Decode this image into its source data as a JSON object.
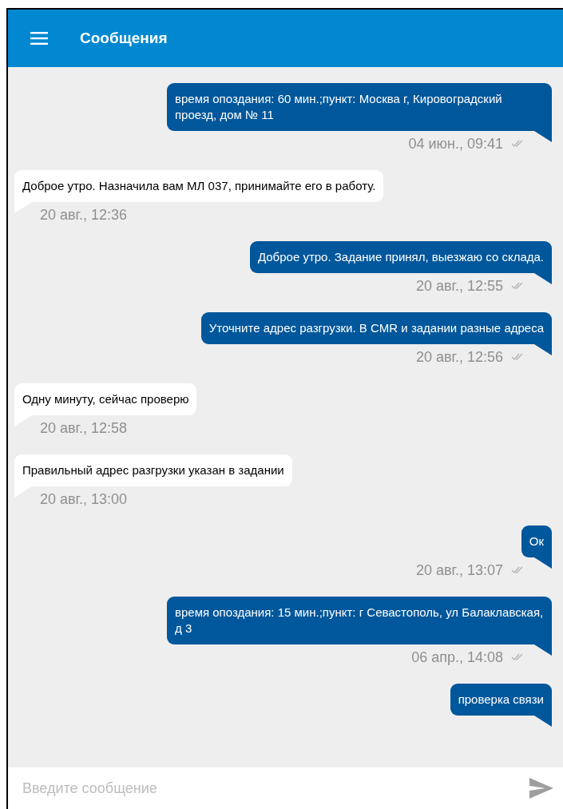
{
  "app_bar": {
    "title": "Сообщения"
  },
  "messages": [
    {
      "kind": "outgoing",
      "text": "время опоздания: 60 мин.;пункт: Москва г, Кировоградский проезд, дом № 11",
      "time": "04 июн., 09:41"
    },
    {
      "kind": "incoming",
      "text": "Доброе утро. Назначила вам МЛ 037, принимайте его в работу.",
      "time": "20 авг., 12:36"
    },
    {
      "kind": "outgoing",
      "text": "Доброе утро. Задание принял, выезжаю со склада.",
      "time": "20 авг., 12:55"
    },
    {
      "kind": "outgoing",
      "text": "Уточните адрес разгрузки. В CMR и задании разные адреса",
      "time": "20 авг., 12:56"
    },
    {
      "kind": "incoming",
      "text": "Одну минуту, сейчас проверю",
      "time": "20 авг., 12:58"
    },
    {
      "kind": "incoming",
      "text": "Правильный адрес разгрузки указан в задании",
      "time": "20 авг., 13:00"
    },
    {
      "kind": "outgoing",
      "text": "Ок",
      "time": "20 авг., 13:07"
    },
    {
      "kind": "outgoing",
      "text": "время опоздания: 15 мин.;пункт: г Севастополь, ул Балаклавская, д 3",
      "time": "06 апр., 14:08"
    },
    {
      "kind": "outgoing",
      "text": "проверка связи"
    }
  ],
  "composer": {
    "placeholder": "Введите сообщение"
  }
}
